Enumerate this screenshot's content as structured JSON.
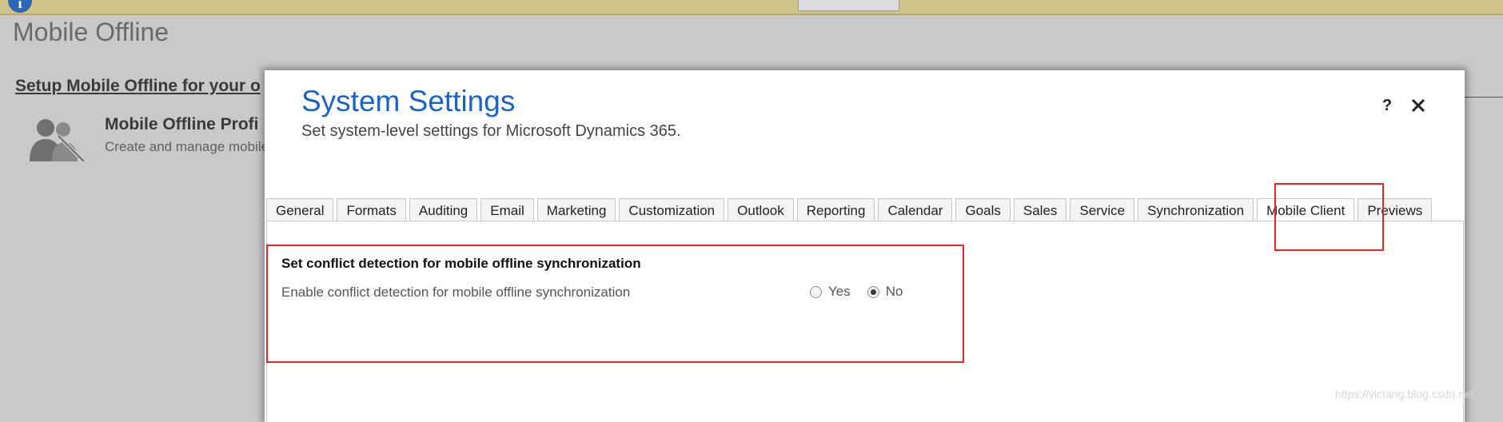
{
  "background": {
    "page_title": "Mobile Offline",
    "setup_heading": "Setup Mobile Offline for your o",
    "profile_title": "Mobile Offline Profi",
    "profile_desc": "Create and manage mobile"
  },
  "dialog": {
    "title": "System Settings",
    "subtitle": "Set system-level settings for Microsoft Dynamics 365.",
    "help_label": "?",
    "tabs": [
      {
        "label": "General"
      },
      {
        "label": "Formats"
      },
      {
        "label": "Auditing"
      },
      {
        "label": "Email"
      },
      {
        "label": "Marketing"
      },
      {
        "label": "Customization"
      },
      {
        "label": "Outlook"
      },
      {
        "label": "Reporting"
      },
      {
        "label": "Calendar"
      },
      {
        "label": "Goals"
      },
      {
        "label": "Sales"
      },
      {
        "label": "Service"
      },
      {
        "label": "Synchronization"
      },
      {
        "label": "Mobile Client"
      },
      {
        "label": "Previews"
      }
    ],
    "active_tab": "Mobile Client",
    "section": {
      "title": "Set conflict detection for mobile offline synchronization",
      "option_label": "Enable conflict detection for mobile offline synchronization",
      "choices": [
        {
          "label": "Yes",
          "checked": false
        },
        {
          "label": "No",
          "checked": true
        }
      ]
    }
  },
  "watermark": "https://victang.blog.csdn.net",
  "colors": {
    "title_blue": "#1d63c3",
    "highlight_red": "#e0282a",
    "overlay_gray": "#c9c9c9"
  },
  "icons": [
    "info-icon",
    "user-group-icon",
    "close-icon"
  ]
}
